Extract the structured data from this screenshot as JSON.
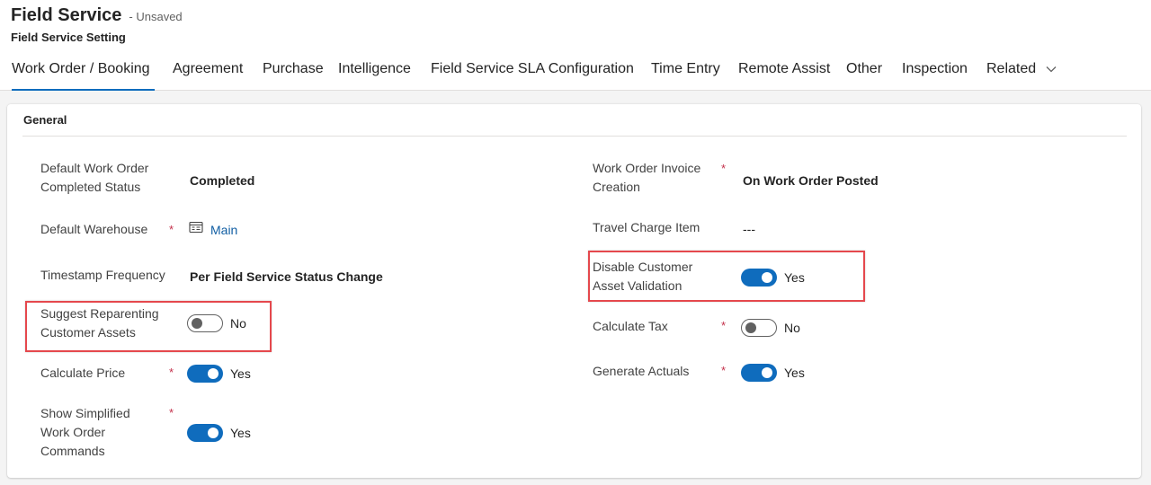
{
  "header": {
    "title": "Field Service",
    "status": "- Unsaved",
    "entity": "Field Service Setting"
  },
  "tabs": [
    {
      "label": "Work Order / Booking",
      "active": true
    },
    {
      "label": "Agreement"
    },
    {
      "label": "Purchase"
    },
    {
      "label": "Intelligence"
    },
    {
      "label": "Field Service SLA Configuration"
    },
    {
      "label": "Time Entry"
    },
    {
      "label": "Remote Assist"
    },
    {
      "label": "Other"
    },
    {
      "label": "Inspection"
    },
    {
      "label": "Related"
    }
  ],
  "section": {
    "title": "General"
  },
  "left_fields": {
    "completed_status": {
      "label": "Default Work Order Completed Status",
      "value": "Completed"
    },
    "warehouse": {
      "label": "Default Warehouse",
      "required": "*",
      "value": "Main",
      "icon": "record-icon"
    },
    "timestamp": {
      "label": "Timestamp Frequency",
      "value": "Per Field Service Status Change"
    },
    "reparenting": {
      "label": "Suggest Reparenting Customer Assets",
      "toggle_text": "No",
      "on": false
    },
    "calc_price": {
      "label": "Calculate Price",
      "required": "*",
      "toggle_text": "Yes",
      "on": true
    },
    "simplified": {
      "label": "Show Simplified Work Order Commands",
      "required": "*",
      "toggle_text": "Yes",
      "on": true
    }
  },
  "right_fields": {
    "invoice_creation": {
      "label": "Work Order Invoice Creation",
      "required": "*",
      "value": "On Work Order Posted"
    },
    "travel_charge": {
      "label": "Travel Charge Item",
      "value": "---"
    },
    "asset_validation": {
      "label": "Disable Customer Asset Validation",
      "toggle_text": "Yes",
      "on": true
    },
    "calc_tax": {
      "label": "Calculate Tax",
      "required": "*",
      "toggle_text": "No",
      "on": false
    },
    "generate_actuals": {
      "label": "Generate Actuals",
      "required": "*",
      "toggle_text": "Yes",
      "on": true
    }
  },
  "colors": {
    "accent": "#0f6cbd",
    "link": "#115ea3",
    "required": "#c4314b",
    "highlight": "#e5484d"
  }
}
